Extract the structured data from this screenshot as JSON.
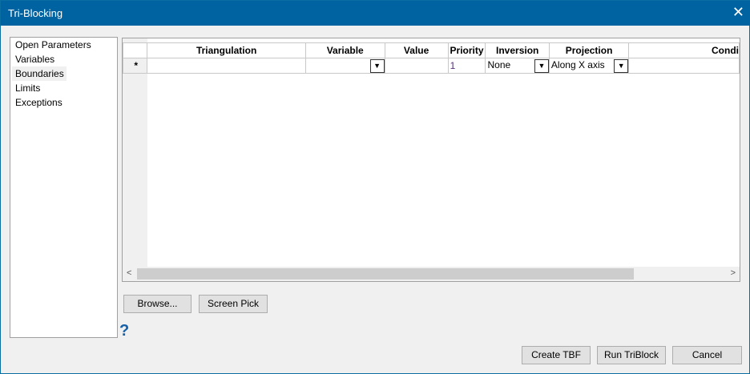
{
  "window": {
    "title": "Tri-Blocking",
    "close_icon": "close-icon"
  },
  "nav": {
    "items": [
      "Open Parameters",
      "Variables",
      "Boundaries",
      "Limits",
      "Exceptions"
    ],
    "selected": "Boundaries"
  },
  "grid": {
    "columns": [
      "Triangulation",
      "Variable",
      "Value",
      "Priority",
      "Inversion",
      "Projection",
      "Condi"
    ],
    "row": {
      "marker": "*",
      "triangulation": "",
      "variable": "",
      "value": "",
      "priority": "1",
      "inversion": "None",
      "projection": "Along X axis",
      "condition": ""
    }
  },
  "buttons": {
    "browse": "Browse...",
    "screen_pick": "Screen Pick",
    "create_tbf": "Create TBF",
    "run_triblock": "Run TriBlock",
    "cancel": "Cancel"
  },
  "help": "?"
}
